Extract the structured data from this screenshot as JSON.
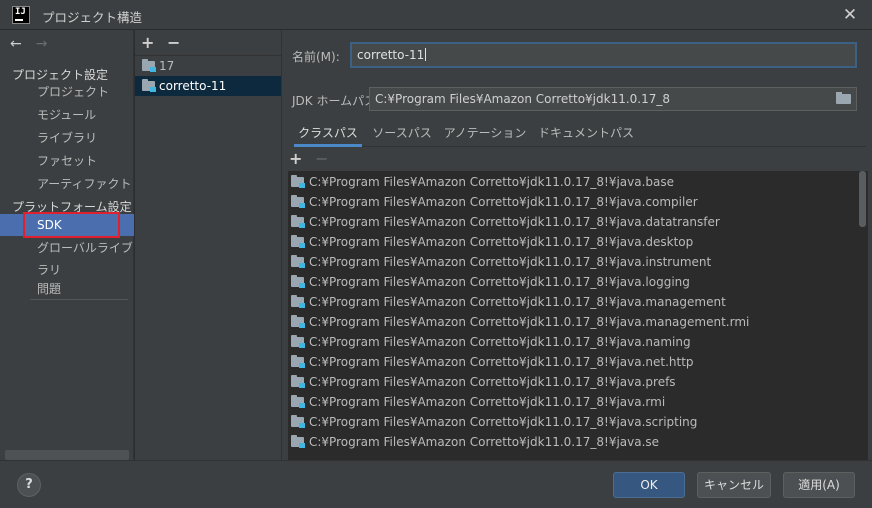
{
  "window": {
    "title": "プロジェクト構造",
    "app_icon_text": "IJ",
    "close_icon": "close-icon"
  },
  "navigation": {
    "back_icon": "arrow-left-icon",
    "forward_icon": "arrow-right-icon"
  },
  "sidebar": {
    "project_settings_heading": "プロジェクト設定",
    "project_items": [
      "プロジェクト",
      "モジュール",
      "ライブラリ",
      "ファセット",
      "アーティファクト"
    ],
    "platform_settings_heading": "プラットフォーム設定",
    "platform_items": [
      "SDK",
      "グローバルライブラリ"
    ],
    "selected_item": "SDK",
    "problems": "問題"
  },
  "sdk_list": {
    "add_label": "+",
    "remove_label": "−",
    "items": [
      "17",
      "corretto-11"
    ],
    "selected": "corretto-11"
  },
  "form": {
    "name_label": "名前(M):",
    "name_value": "corretto-11",
    "home_label": "JDK ホームパス:",
    "home_value": "C:¥Program Files¥Amazon Corretto¥jdk11.0.17_8"
  },
  "tabs": [
    "クラスパス",
    "ソースパス",
    "アノテーション",
    "ドキュメントパス"
  ],
  "active_tab": "クラスパス",
  "classpath": {
    "add_label": "+",
    "remove_label": "−",
    "entries": [
      "C:¥Program Files¥Amazon Corretto¥jdk11.0.17_8!¥java.base",
      "C:¥Program Files¥Amazon Corretto¥jdk11.0.17_8!¥java.compiler",
      "C:¥Program Files¥Amazon Corretto¥jdk11.0.17_8!¥java.datatransfer",
      "C:¥Program Files¥Amazon Corretto¥jdk11.0.17_8!¥java.desktop",
      "C:¥Program Files¥Amazon Corretto¥jdk11.0.17_8!¥java.instrument",
      "C:¥Program Files¥Amazon Corretto¥jdk11.0.17_8!¥java.logging",
      "C:¥Program Files¥Amazon Corretto¥jdk11.0.17_8!¥java.management",
      "C:¥Program Files¥Amazon Corretto¥jdk11.0.17_8!¥java.management.rmi",
      "C:¥Program Files¥Amazon Corretto¥jdk11.0.17_8!¥java.naming",
      "C:¥Program Files¥Amazon Corretto¥jdk11.0.17_8!¥java.net.http",
      "C:¥Program Files¥Amazon Corretto¥jdk11.0.17_8!¥java.prefs",
      "C:¥Program Files¥Amazon Corretto¥jdk11.0.17_8!¥java.rmi",
      "C:¥Program Files¥Amazon Corretto¥jdk11.0.17_8!¥java.scripting",
      "C:¥Program Files¥Amazon Corretto¥jdk11.0.17_8!¥java.se"
    ]
  },
  "footer": {
    "help_label": "?",
    "ok_label": "OK",
    "cancel_label": "キャンセル",
    "apply_label": "適用(A)"
  },
  "colors": {
    "accent_selection": "#4b6eaf",
    "highlight_box": "#e0202e",
    "primary_button": "#365880"
  }
}
